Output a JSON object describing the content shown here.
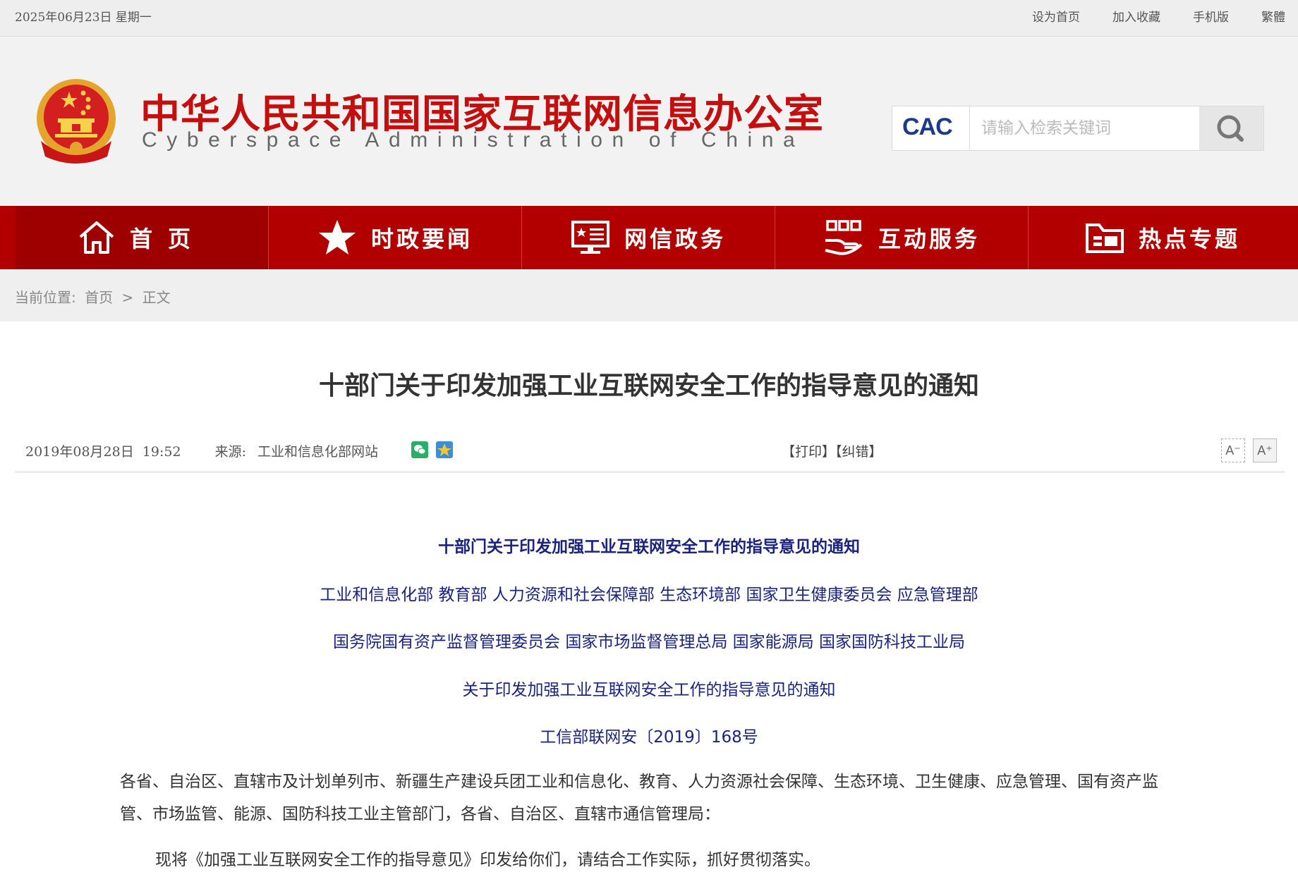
{
  "topbar": {
    "date": "2025年06月23日  星期一",
    "links": [
      "设为首页",
      "加入收藏",
      "手机版",
      "繁體"
    ]
  },
  "header": {
    "title_cn": "中华人民共和国国家互联网信息办公室",
    "title_en": "Cyberspace Administration of China",
    "logo_text": "CAC",
    "search_placeholder": "请输入检索关键词"
  },
  "nav": {
    "items": [
      {
        "label": "首页",
        "icon": "home-icon"
      },
      {
        "label": "时政要闻",
        "icon": "star-icon"
      },
      {
        "label": "网信政务",
        "icon": "monitor-icon"
      },
      {
        "label": "互动服务",
        "icon": "hand-service-icon"
      },
      {
        "label": "热点专题",
        "icon": "folder-icon"
      }
    ]
  },
  "breadcrumb": {
    "label": "当前位置:",
    "home": "首页",
    "sep": ">",
    "current": "正文"
  },
  "article": {
    "title": "十部门关于印发加强工业互联网安全工作的指导意见的通知",
    "datetime": "2019年08月28日  19:52",
    "source_label": "来源:",
    "source": "工业和信息化部网站",
    "print": "【打印】",
    "correct": "【纠错】",
    "font_minus": "A⁻",
    "font_plus": "A⁺",
    "doc_title": "十部门关于印发加强工业互联网安全工作的指导意见的通知",
    "depts_line1": "工业和信息化部 教育部 人力资源和社会保障部 生态环境部 国家卫生健康委员会 应急管理部",
    "depts_line2": "国务院国有资产监督管理委员会 国家市场监督管理总局 国家能源局 国家国防科技工业局",
    "notice_title": "关于印发加强工业互联网安全工作的指导意见的通知",
    "doc_number": "工信部联网安〔2019〕168号",
    "para1": "各省、自治区、直辖市及计划单列市、新疆生产建设兵团工业和信息化、教育、人力资源社会保障、生态环境、卫生健康、应急管理、国有资产监管、市场监管、能源、国防科技工业主管部门，各省、自治区、直辖市通信管理局：",
    "para2": "现将《加强工业互联网安全工作的指导意见》印发给你们，请结合工作实际，抓好贯彻落实。"
  },
  "colors": {
    "brand_red": "#b20000",
    "title_red": "#c40f0f",
    "doc_blue": "#1a237e"
  }
}
